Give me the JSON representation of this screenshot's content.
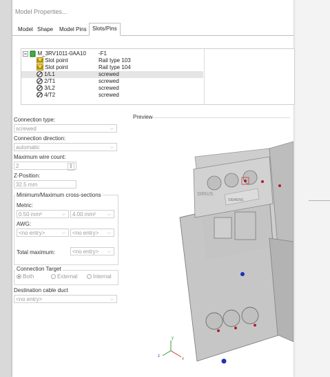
{
  "window": {
    "title": "Model Properties..."
  },
  "tabs": [
    {
      "label": "Model"
    },
    {
      "label": "Shape"
    },
    {
      "label": "Model Pins"
    },
    {
      "label": "Slots/Pins"
    }
  ],
  "tree": {
    "root": {
      "name": "M_3RV1011-0AA10",
      "value": "-F1"
    },
    "rows": [
      {
        "name": "Slot point",
        "value": "Rail type 103"
      },
      {
        "name": "Slot point",
        "value": "Rail type 104"
      },
      {
        "name": "1/L1",
        "value": "screwed"
      },
      {
        "name": "2/T1",
        "value": "screwed"
      },
      {
        "name": "3/L2",
        "value": "screwed"
      },
      {
        "name": "4/T2",
        "value": "screwed"
      }
    ]
  },
  "form": {
    "connection_type_label": "Connection type:",
    "connection_type_value": "screwed",
    "connection_direction_label": "Connection direction:",
    "connection_direction_value": "automatic",
    "max_wire_count_label": "Maximum wire count:",
    "max_wire_count_value": "2",
    "z_position_label": "Z-Position:",
    "z_position_value": "32.5 mm",
    "cross_sections_label": "Minimum/Maximum cross-sections",
    "metric_label": "Metric:",
    "metric_min": "0.50 mm²",
    "metric_max": "4.00 mm²",
    "awg_label": "AWG:",
    "awg_min": "<no entry>",
    "awg_max": "<no entry>",
    "total_max_label": "Total maximum:",
    "total_max_value": "<no entry>",
    "connection_target_label": "Connection Target",
    "target_both": "Both",
    "target_external": "External",
    "target_internal": "Internal",
    "destination_duct_label": "Destination cable duct",
    "destination_duct_value": "<no entry>"
  },
  "preview": {
    "label": "Preview",
    "device_brand": "SIRIUS",
    "device_maker": "SIEMENS",
    "axis_y": "y",
    "axis_x": "x",
    "axis_z": "z"
  }
}
